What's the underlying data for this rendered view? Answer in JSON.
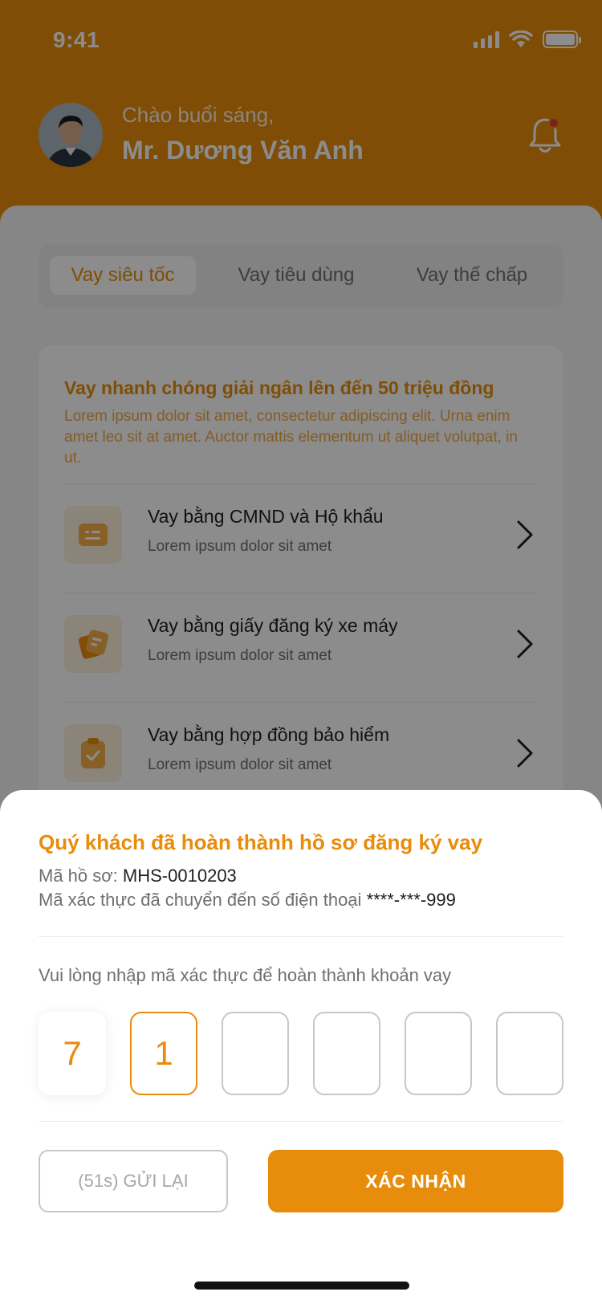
{
  "status_bar": {
    "time": "9:41"
  },
  "header": {
    "greeting": "Chào buổi sáng,",
    "user_name": "Mr. Dương Văn Anh"
  },
  "tabs": [
    {
      "label": "Vay siêu tốc",
      "active": true
    },
    {
      "label": "Vay tiêu dùng",
      "active": false
    },
    {
      "label": "Vay thế chấp",
      "active": false
    }
  ],
  "promo": {
    "title": "Vay nhanh chóng giải ngân lên đến 50 triệu đồng",
    "description": "Lorem ipsum dolor sit amet, consectetur adipiscing elit. Urna enim amet leo sit at amet. Auctor mattis elementum ut aliquet volutpat, in ut."
  },
  "loan_options": [
    {
      "title": "Vay bằng CMND và Hộ khẩu",
      "subtitle": "Lorem ipsum dolor sit amet",
      "icon": "id-card-icon"
    },
    {
      "title": "Vay bằng giấy đăng ký xe máy",
      "subtitle": "Lorem ipsum dolor sit amet",
      "icon": "document-icon"
    },
    {
      "title": "Vay bằng hợp đồng bảo hiểm",
      "subtitle": "Lorem ipsum dolor sit amet",
      "icon": "clipboard-check-icon"
    }
  ],
  "sheet": {
    "title": "Quý khách đã hoàn thành hồ sơ đăng ký vay",
    "file_label": "Mã hồ sơ:",
    "file_code": "MHS-0010203",
    "phone_label": "Mã xác thực đã chuyển đến số điện thoại",
    "phone_masked": "****-***-999",
    "otp_prompt": "Vui lòng nhập mã xác thực để hoàn thành khoản vay",
    "otp_digits": [
      "7",
      "1",
      "",
      "",
      "",
      ""
    ],
    "resend_label": "(51s) GỬI LẠI",
    "confirm_label": "XÁC NHẬN"
  },
  "colors": {
    "accent": "#e88c0b",
    "notification_dot": "#e53935"
  }
}
